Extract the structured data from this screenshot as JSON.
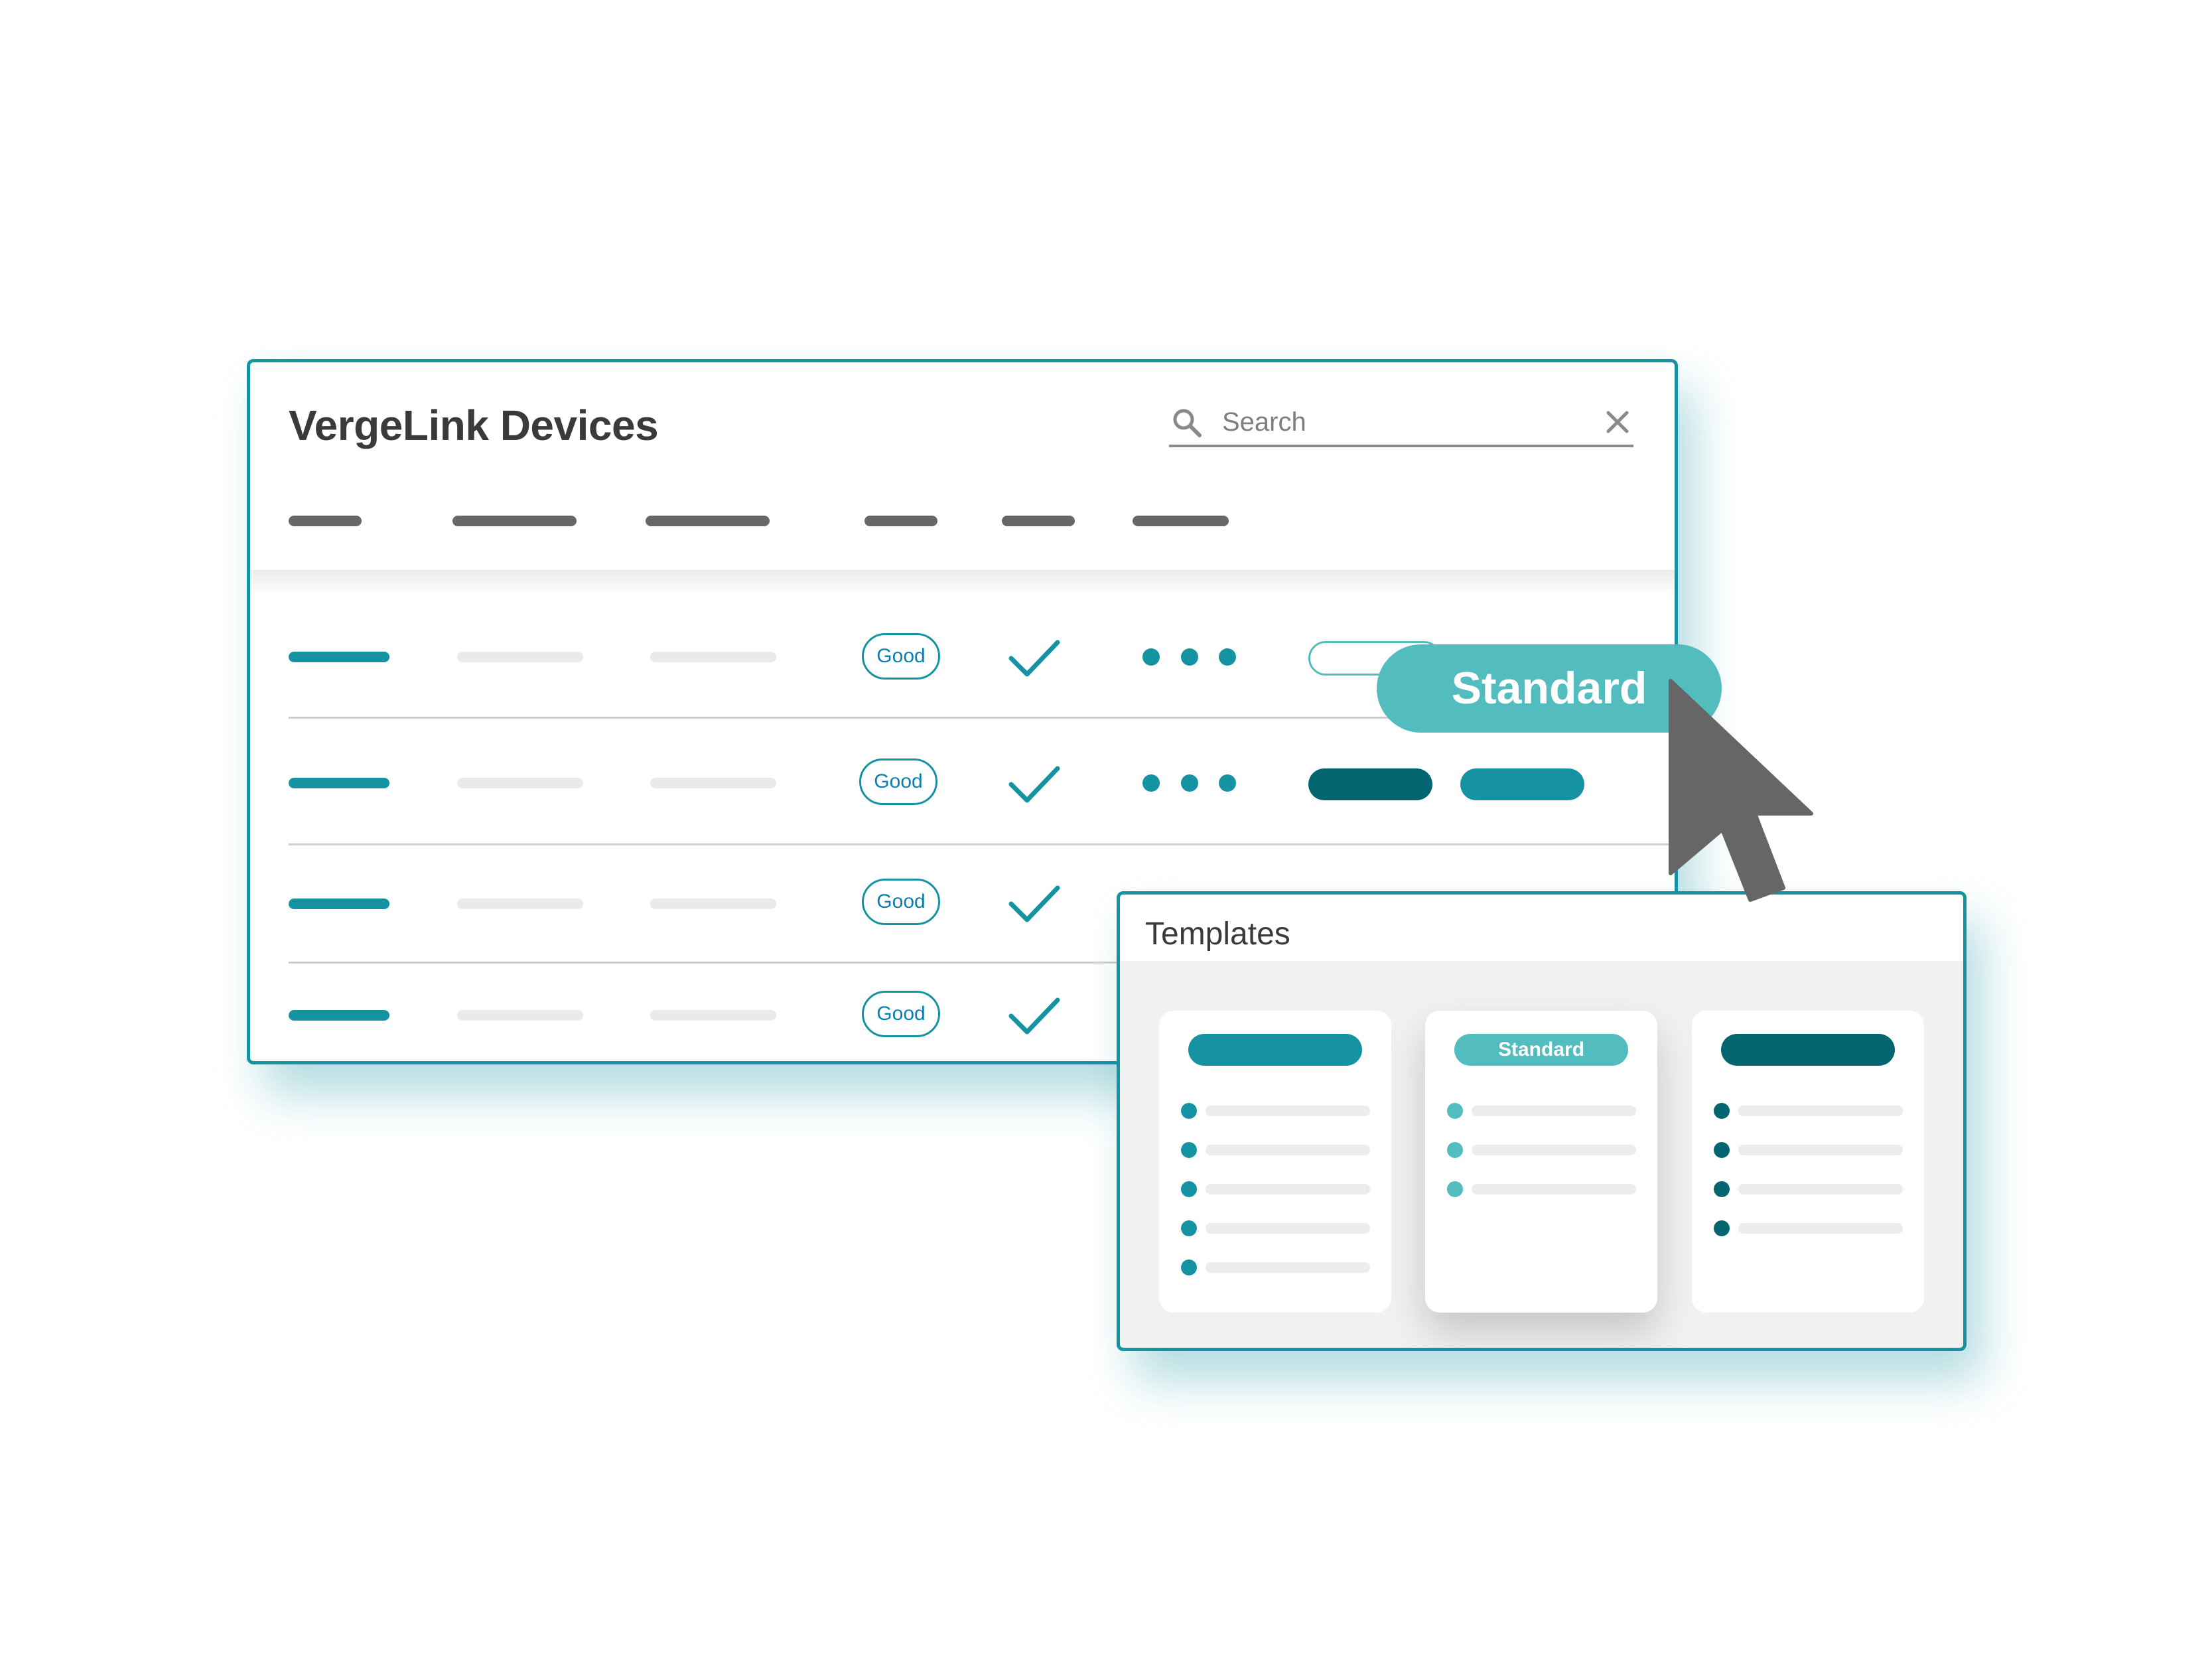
{
  "colors": {
    "accent": "#1593a3",
    "accent_light": "#52bcbe",
    "accent_dark": "#036570",
    "header_bar": "#676767",
    "placeholder_bar": "#eaeaea",
    "cursor": "#666666"
  },
  "devices_window": {
    "title": "VergeLink Devices",
    "search": {
      "icon": "search-icon",
      "placeholder": "Search",
      "clear_icon": "close-icon"
    },
    "rows": [
      {
        "status": "Good",
        "check_icon": "checkmark-icon",
        "menu_icon": "more-dots-icon"
      },
      {
        "status": "Good",
        "check_icon": "checkmark-icon",
        "menu_icon": "more-dots-icon"
      },
      {
        "status": "Good",
        "check_icon": "checkmark-icon"
      },
      {
        "status": "Good",
        "check_icon": "checkmark-icon"
      }
    ]
  },
  "floating_button": {
    "label": "Standard"
  },
  "cursor": {
    "icon": "arrow-cursor-icon"
  },
  "templates_panel": {
    "title": "Templates",
    "cards": [
      {
        "pill_label": "",
        "color": "#1593a3",
        "bullet_count": 5
      },
      {
        "pill_label": "Standard",
        "color": "#52bcbe",
        "bullet_count": 3
      },
      {
        "pill_label": "",
        "color": "#036570",
        "bullet_count": 4
      }
    ]
  }
}
